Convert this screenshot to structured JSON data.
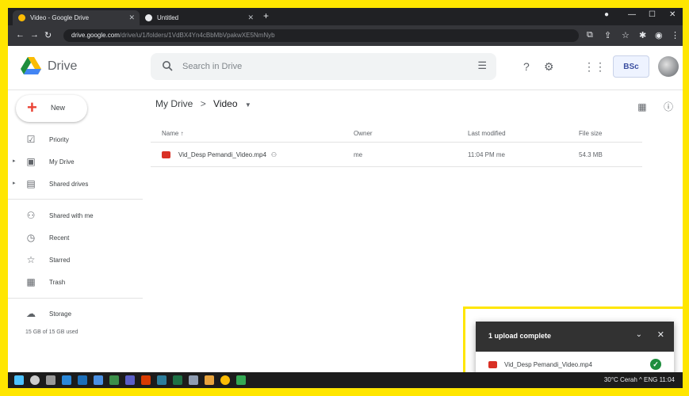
{
  "browser": {
    "tabs": [
      {
        "title": "Video - Google Drive",
        "active": true,
        "favicon_color": "#fbbc04"
      },
      {
        "title": "Untitled",
        "active": false,
        "favicon_color": "#e8eaed"
      }
    ],
    "new_tab_symbol": "+",
    "window_controls": [
      "—",
      "☐",
      "✕"
    ],
    "url_host": "drive.google.com",
    "url_path": "/drive/u/1/folders/1VdBX4Yn4cBbMbVpakwXE5NmNyb"
  },
  "drive": {
    "logo_text": "Drive",
    "search_placeholder": "Search in Drive",
    "new_label": "New",
    "nav": [
      {
        "label": "Priority",
        "icon": "priority-icon",
        "glyph": "☑",
        "expandable": false
      },
      {
        "label": "My Drive",
        "icon": "my-drive-icon",
        "glyph": "▣",
        "expandable": true
      },
      {
        "label": "Shared drives",
        "icon": "shared-drives-icon",
        "glyph": "▤",
        "expandable": true
      },
      {
        "label": "Shared with me",
        "icon": "shared-with-me-icon",
        "glyph": "👥",
        "expandable": false
      },
      {
        "label": "Recent",
        "icon": "recent-icon",
        "glyph": "◷",
        "expandable": false
      },
      {
        "label": "Starred",
        "icon": "star-icon",
        "glyph": "☆",
        "expandable": false
      },
      {
        "label": "Trash",
        "icon": "trash-icon",
        "glyph": "🗑",
        "expandable": false
      },
      {
        "label": "Storage",
        "icon": "cloud-icon",
        "glyph": "☁",
        "expandable": false
      }
    ],
    "storage_text": "15 GB of 15 GB used",
    "breadcrumb": {
      "root": "My Drive",
      "separator": ">",
      "current": "Video"
    },
    "columns": [
      "Name",
      "Owner",
      "Last modified",
      "File size"
    ],
    "files": [
      {
        "name": "Vid_Desp Pemandi_Video.mp4",
        "owner": "me",
        "modified": "11:04 PM me",
        "size": "54.3 MB"
      }
    ]
  },
  "upload_panel": {
    "title": "1 upload complete",
    "file_name": "Vid_Desp Pemandi_Video.mp4",
    "status": "complete"
  },
  "taskbar": {
    "tray_text": "30°C Cerah  ^  ENG  11:04"
  },
  "colors": {
    "highlight": "#ffe600",
    "video_file": "#d93025",
    "success": "#1e8e3e"
  }
}
